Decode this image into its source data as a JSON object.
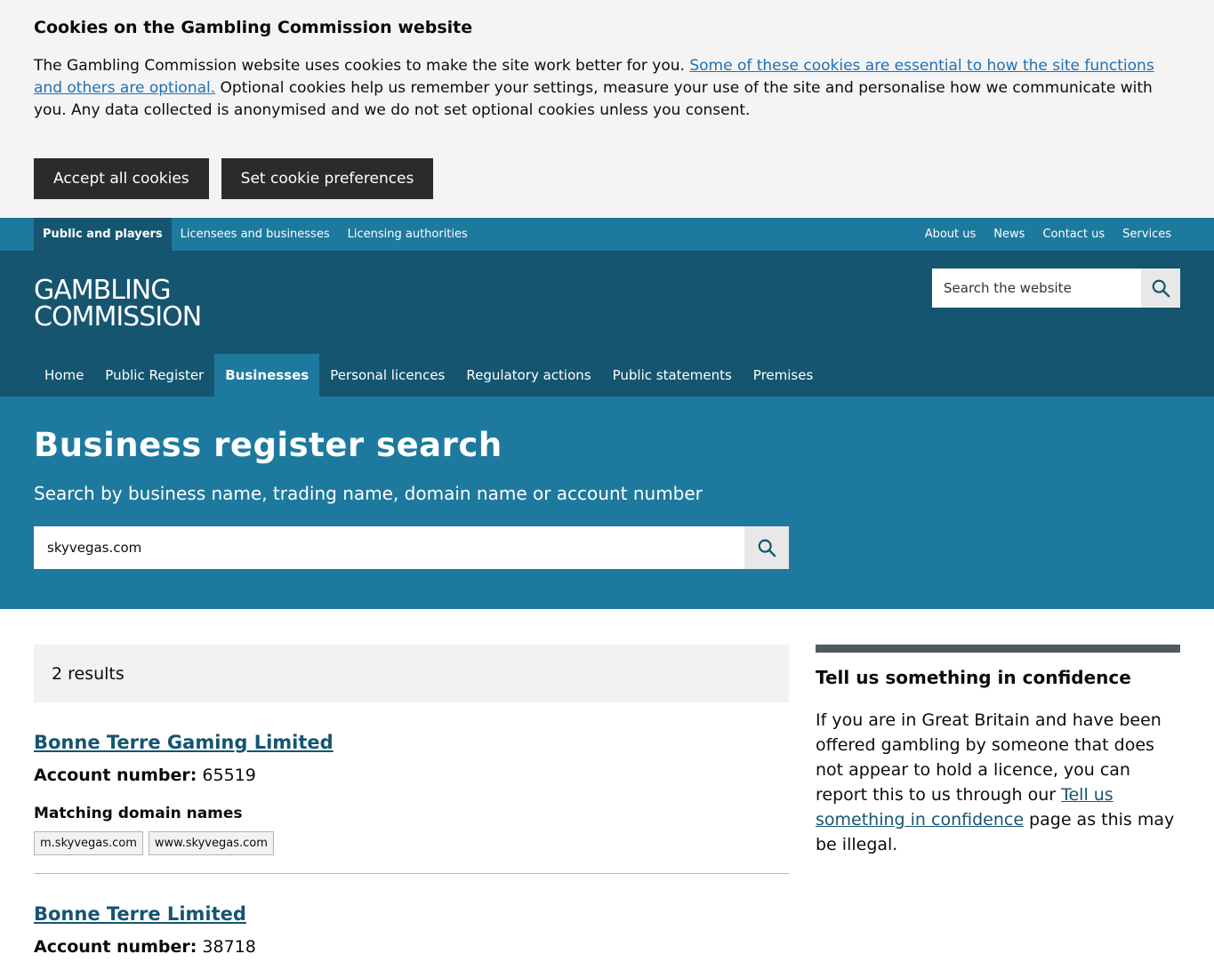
{
  "cookie_banner": {
    "title": "Cookies on the Gambling Commission website",
    "text_before": "The Gambling Commission website uses cookies to make the site work better for you. ",
    "link_text": "Some of these cookies are essential to how the site functions and others are optional.",
    "text_after": " Optional cookies help us remember your settings, measure your use of the site and personalise how we communicate with you. Any data collected is anonymised and we do not set optional cookies unless you consent.",
    "accept_label": "Accept all cookies",
    "preferences_label": "Set cookie preferences"
  },
  "top_nav": {
    "left": [
      "Public and players",
      "Licensees and businesses",
      "Licensing authorities"
    ],
    "right": [
      "About us",
      "News",
      "Contact us",
      "Services"
    ]
  },
  "header": {
    "logo_line1": "GAMBLING",
    "logo_line2": "COMMISSION",
    "search_placeholder": "Search the website"
  },
  "main_nav": [
    "Home",
    "Public Register",
    "Businesses",
    "Personal licences",
    "Regulatory actions",
    "Public statements",
    "Premises"
  ],
  "hero": {
    "title": "Business register search",
    "subtitle": "Search by business name, trading name, domain name or account number",
    "search_value": "skyvegas.com"
  },
  "results": {
    "count_text": "2 results",
    "account_label": "Account number:",
    "domains_heading": "Matching domain names",
    "items": [
      {
        "name": "Bonne Terre Gaming Limited",
        "account": "65519",
        "domains": [
          "m.skyvegas.com",
          "www.skyvegas.com"
        ]
      },
      {
        "name": "Bonne Terre Limited",
        "account": "38718"
      }
    ]
  },
  "sidebar": {
    "title": "Tell us something in confidence",
    "text_before": "If you are in Great Britain and have been offered gambling by someone that does not appear to hold a licence, you can report this to us through our ",
    "link_text": "Tell us something in confidence",
    "text_after": " page as this may be illegal."
  },
  "colors": {
    "top_nav": "#1d7a9e",
    "header": "#155570",
    "hero": "#1d7a9e",
    "button_dark": "#2b2b2b",
    "link": "#155570"
  }
}
